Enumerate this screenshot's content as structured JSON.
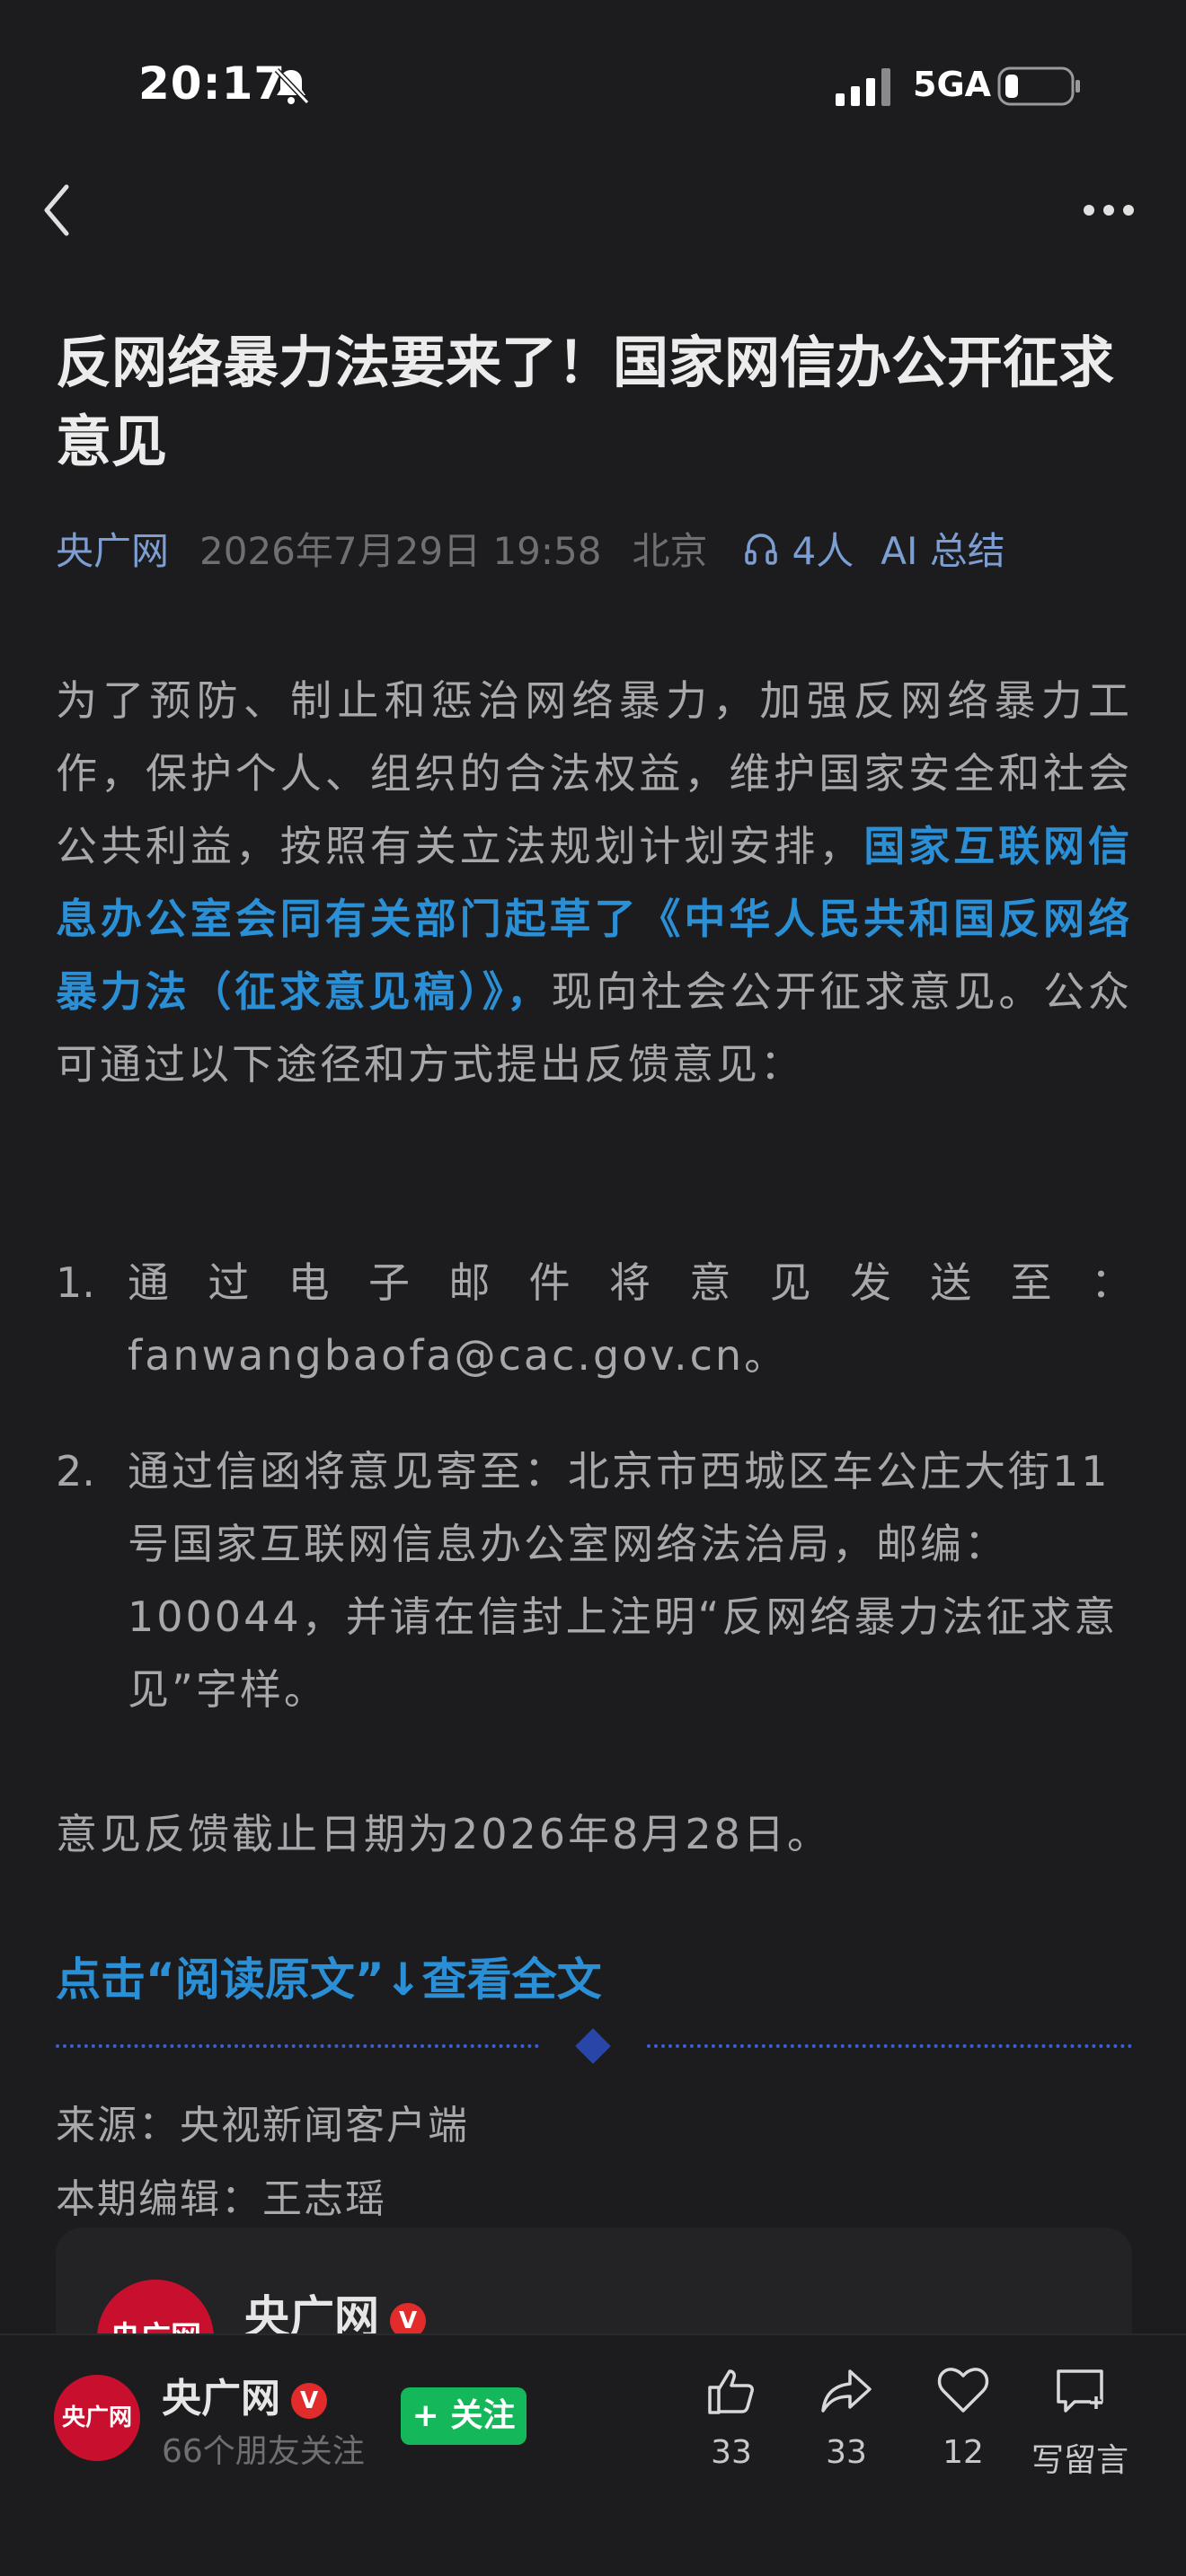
{
  "status_bar": {
    "time": "20:17",
    "network": "5GA"
  },
  "article": {
    "title": "反网络暴力法要来了！国家网信办公开征求意见",
    "source": "央广网",
    "date": "2026年7月29日 19:58",
    "location": "北京",
    "listeners": "4人",
    "ai_summary": "AI 总结",
    "para1_a": "为了预防、制止和惩治网络暴力，加强反网络暴力工作，保护个人、组织的合法权益，维护国家安全和社会公共利益，按照有关立法规划计划安排，",
    "para1_highlight": "国家互联网信息办公室会同有关部门起草了《中华人民共和国反网络暴力法（征求意见稿）》，",
    "para1_b": "现向社会公开征求意见。公众可通过以下途径和方式提出反馈意见：",
    "list": [
      {
        "num": "1.",
        "line1_chars": [
          "通",
          "过",
          "电",
          "子",
          "邮",
          "件",
          "将",
          "意",
          "见",
          "发",
          "送",
          "至",
          "："
        ],
        "line2": "fanwangbaofa@cac.gov.cn。"
      },
      {
        "num": "2.",
        "text": "通过信函将意见寄至：北京市西城区车公庄大街11号国家互联网信息办公室网络法治局，邮编：100044，并请在信封上注明“反网络暴力法征求意见”字样。"
      }
    ],
    "deadline": "意见反馈截止日期为2026年8月28日。",
    "read_more": "点击“阅读原文”↓查看全文",
    "source_line": "来源：央视新闻客户端",
    "editor_line": "本期编辑：王志瑶"
  },
  "account_card": {
    "logo_text": "央广网",
    "name": "央广网",
    "badge": "V"
  },
  "bottom_bar": {
    "logo_text": "央广网",
    "name": "央广网",
    "badge": "V",
    "friends": "66个朋友关注",
    "follow": "+ 关注",
    "like_count": "33",
    "share_count": "33",
    "fav_count": "12",
    "comment_label": "写留言"
  },
  "colors": {
    "background": "#1c1c1e",
    "link": "#2b8fd6",
    "meta_accent": "#7d9ed3",
    "follow": "#14b85a",
    "brand_red": "#c8102e"
  }
}
